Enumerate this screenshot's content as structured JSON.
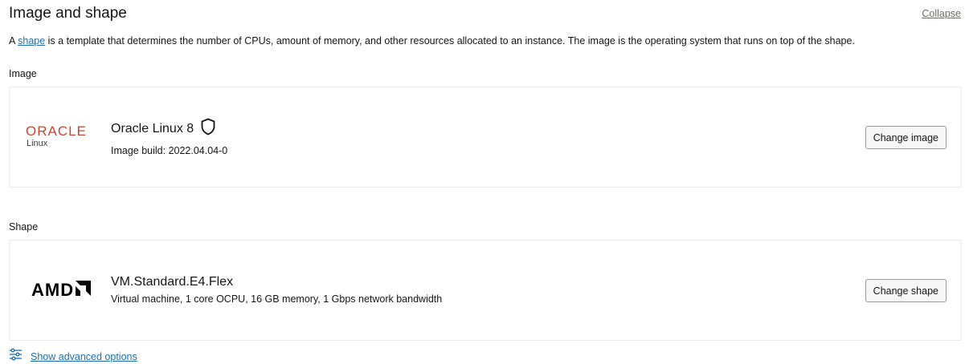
{
  "header": {
    "title": "Image and shape",
    "collapse_label": "Collapse"
  },
  "description": {
    "prefix": "A ",
    "link": "shape",
    "suffix": " is a template that determines the number of CPUs, amount of memory, and other resources allocated to an instance. The image is the operating system that runs on top of the shape."
  },
  "image": {
    "label": "Image",
    "logo_word": "ORACLE",
    "logo_sub": "Linux",
    "name": "Oracle Linux 8",
    "build": "Image build: 2022.04.04-0",
    "button": "Change image"
  },
  "shape": {
    "label": "Shape",
    "logo_word": "AMD",
    "name": "VM.Standard.E4.Flex",
    "details": "Virtual machine, 1 core OCPU, 16 GB memory, 1 Gbps network bandwidth",
    "button": "Change shape"
  },
  "advanced": {
    "label": "Show advanced options"
  },
  "colors": {
    "oracle_red": "#c74634",
    "link_blue": "#1a6fb5",
    "border": "#ece9e6"
  }
}
